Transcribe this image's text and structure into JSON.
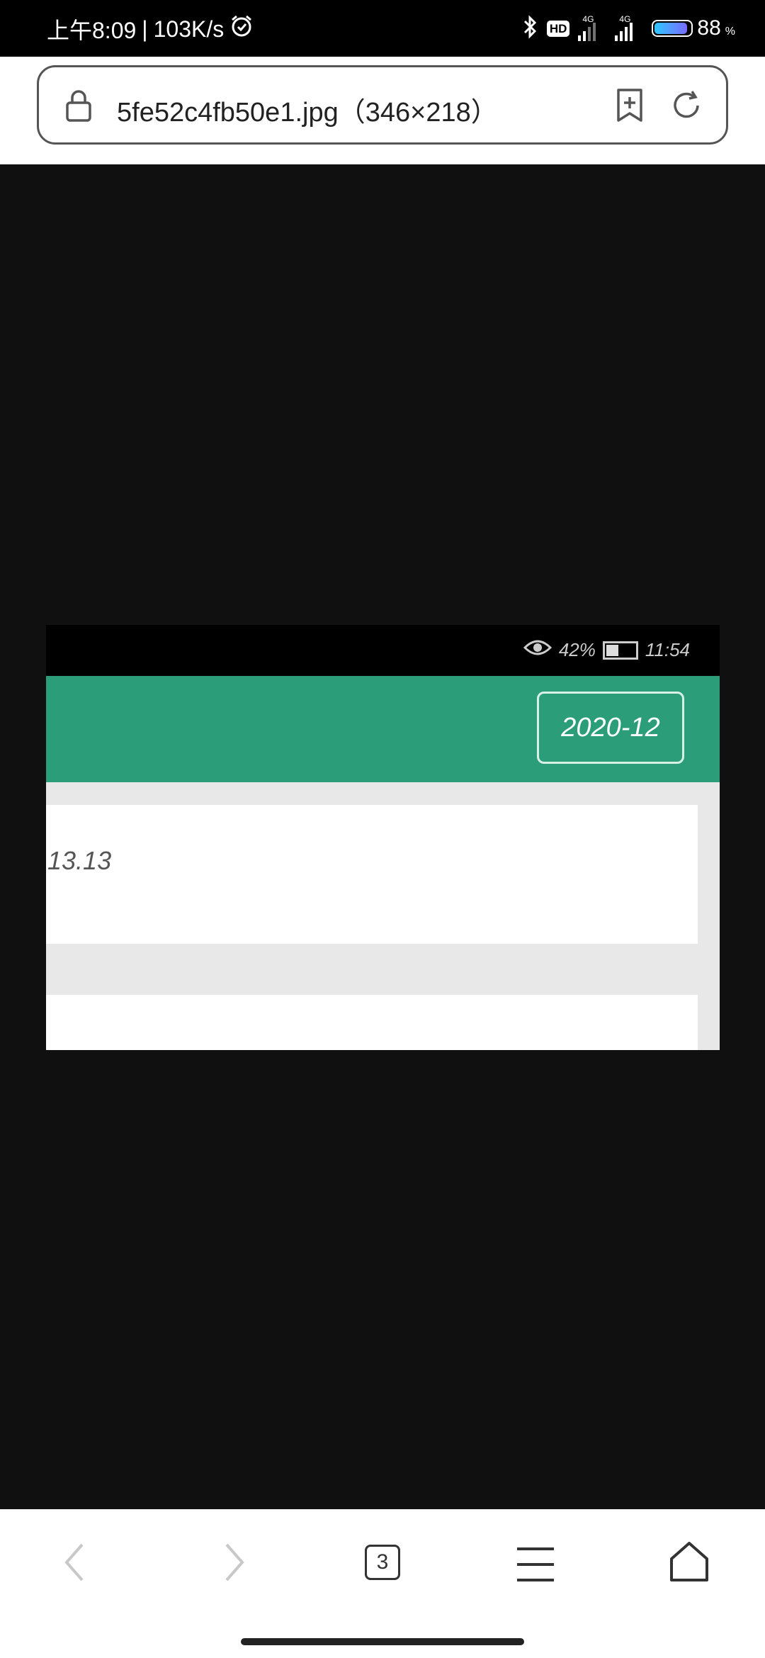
{
  "status_bar": {
    "time": "上午8:09",
    "separator": "|",
    "net_speed": "103K/s",
    "hd_badge": "HD",
    "network_1": "4G",
    "network_2": "4G",
    "battery_percent": "88",
    "battery_unit": "%"
  },
  "address_bar": {
    "url_text": "5fe52c4fb50e1.jpg（346×218）"
  },
  "image_content": {
    "status_battery": "42%",
    "status_time": "11:54",
    "date_button": "2020-12",
    "amount": "13.13"
  },
  "toolbar": {
    "tabs_count": "3"
  }
}
